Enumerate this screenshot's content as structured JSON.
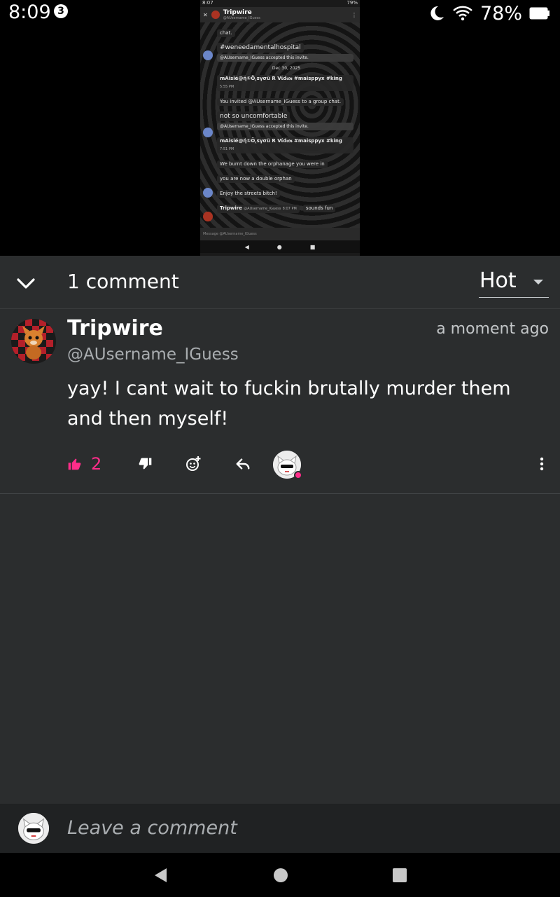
{
  "status_bar": {
    "time": "8:09",
    "notification_count": "3",
    "battery": "78%"
  },
  "embedded_screenshot": {
    "status_time": "8:07",
    "status_battery": "79%",
    "chat_name": "Tripwire",
    "chat_handle": "@AUsername_IGuess",
    "messages": [
      {
        "text": "chat."
      },
      {
        "text": "#weneedamentalhospital"
      },
      {
        "text": "@AUsername_IGuess accepted this invite."
      },
      {
        "text": "Dec 30, 2025"
      },
      {
        "author": "mAisié@ή①Ȍ⁁sγσü R Vίd𝔢𝔬𝔰 #maisppyx #king",
        "time": "5:55 PM"
      },
      {
        "text": "You invited @AUsername_IGuess to a group chat."
      },
      {
        "text": "not so uncomfortable"
      },
      {
        "text": "@AUsername_IGuess accepted this invite."
      },
      {
        "author": "mAisié@ή①Ȍ⁁sγσü R Vίd𝔢𝔬𝔰 #maisppyx #king",
        "time": "7:51 PM"
      },
      {
        "text": "We burnt down the orphanage you were in"
      },
      {
        "text": "you are now a double orphan"
      },
      {
        "text": "Enjoy the streets bitch!"
      },
      {
        "author": "Tripwire",
        "handle": "@AUsername_IGuess",
        "time": "8:07 PM"
      },
      {
        "text": "sounds fun"
      }
    ],
    "input_placeholder": "Message @AUsername_IGuess"
  },
  "comments_header": {
    "count_label": "1 comment",
    "sort_label": "Hot"
  },
  "comment": {
    "author": "Tripwire",
    "handle": "@AUsername_IGuess",
    "time": "a moment ago",
    "text": "yay! I cant wait to fuckin brutally murder them and then myself!",
    "like_count": "2"
  },
  "leave_comment": {
    "placeholder": "Leave a comment"
  },
  "colors": {
    "accent_pink": "#ff2d8a",
    "panel_bg": "#2b2d2e",
    "input_bar_bg": "#202223"
  },
  "icons": [
    "chevron-down-icon",
    "thumbs-up-icon",
    "thumbs-down-icon",
    "add-reaction-icon",
    "reply-icon",
    "more-vert-icon",
    "back-icon",
    "home-icon",
    "recents-icon",
    "moon-icon",
    "wifi-icon",
    "battery-icon"
  ]
}
